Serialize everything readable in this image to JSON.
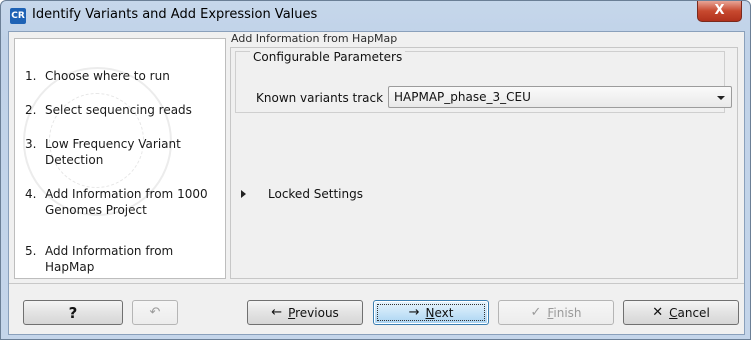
{
  "window": {
    "app_icon": "CR",
    "title": "Identify Variants and Add Expression Values",
    "close_glyph": "X"
  },
  "steps": [
    {
      "num": "1.",
      "label": "Choose where to run"
    },
    {
      "num": "2.",
      "label": "Select sequencing reads"
    },
    {
      "num": "3.",
      "label": "Low Frequency Variant Detection"
    },
    {
      "num": "4.",
      "label": "Add Information from 1000 Genomes Project"
    },
    {
      "num": "5.",
      "label": "Add Information from HapMap"
    }
  ],
  "panel": {
    "title": "Add Information from HapMap",
    "group_title": "Configurable Parameters",
    "known_variants_label": "Known variants track",
    "known_variants_value": "HAPMAP_phase_3_CEU",
    "locked_label": "Locked Settings"
  },
  "buttons": {
    "help": "?",
    "previous_icon": "arrow-left-icon",
    "previous_label_u": "P",
    "previous_label_rest": "revious",
    "next_label_u": "N",
    "next_label_rest": "ext",
    "finish_label_u": "F",
    "finish_label_rest": "inish",
    "cancel_label_u": "C",
    "cancel_label_rest": "ancel"
  },
  "colors": {
    "accent": "#1e62b5",
    "close_button": "#c7492f",
    "default_button": "#c9e5f8"
  }
}
